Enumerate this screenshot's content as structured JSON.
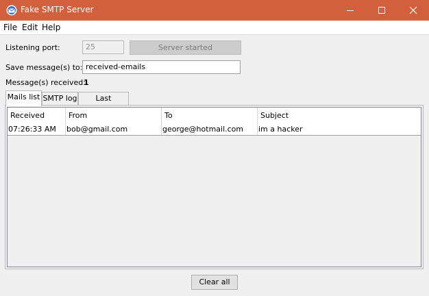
{
  "window": {
    "title": "Fake SMTP Server",
    "icon": "envelope-icon"
  },
  "menu": [
    "File",
    "Edit",
    "Help"
  ],
  "form": {
    "port_label": "Listening port:",
    "port_value": "25",
    "server_button": "Server started",
    "save_label": "Save message(s) to:",
    "save_value": "received-emails",
    "received_label": "Message(s) received:",
    "received_count": "1"
  },
  "tabs": [
    "Mails list",
    "SMTP log",
    "Last message"
  ],
  "table": {
    "columns": [
      "Received",
      "From",
      "To",
      "Subject"
    ],
    "rows": [
      [
        "07:26:33 AM",
        "bob@gmail.com",
        "george@hotmail.com",
        "im a hacker"
      ]
    ]
  },
  "footer": {
    "clear_button": "Clear all"
  },
  "colors": {
    "titlebar": "#d2603d"
  }
}
